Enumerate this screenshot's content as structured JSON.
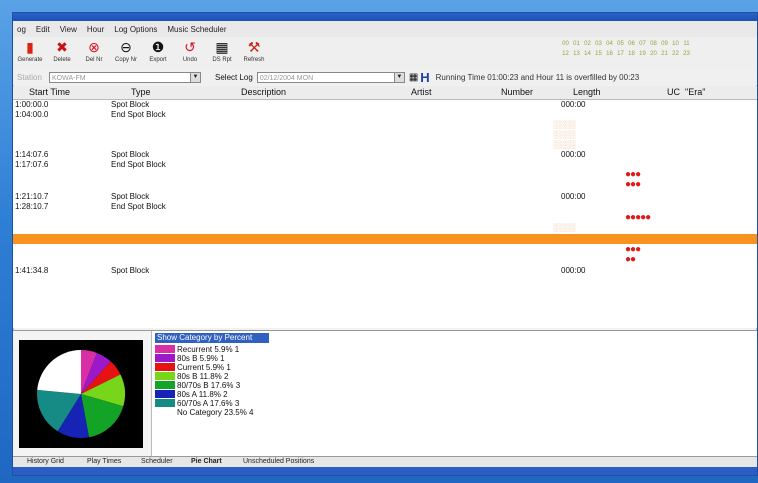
{
  "menu": [
    "og",
    "Edit",
    "View",
    "Hour",
    "Log Options",
    "Music Scheduler"
  ],
  "toolbar": {
    "buttons": [
      {
        "label": "Generate",
        "icon": "generate-icon"
      },
      {
        "label": "Delete",
        "icon": "delete-icon"
      },
      {
        "label": "Del Nr",
        "icon": "del-nr-icon"
      },
      {
        "label": "Copy Nr",
        "icon": "copy-nr-icon"
      },
      {
        "label": "Export",
        "icon": "export-icon"
      },
      {
        "label": "Undo",
        "icon": "undo-icon"
      },
      {
        "label": "DS Rpt",
        "icon": "report-icon"
      },
      {
        "label": "Refresh",
        "icon": "refresh-icon"
      }
    ],
    "hours_row1": [
      "00",
      "01",
      "02",
      "03",
      "04",
      "05",
      "06",
      "07",
      "08",
      "09",
      "10",
      "11"
    ],
    "hours_row2": [
      "12",
      "13",
      "14",
      "15",
      "16",
      "17",
      "18",
      "19",
      "20",
      "21",
      "22",
      "23"
    ]
  },
  "selector": {
    "station_label": "Station",
    "station_value": "KOWA-FM",
    "log_label": "Select Log",
    "log_value": "02/12/2004 MON",
    "running_time": "Running Time 01:00:23 and Hour 11 is overfilled by 00:23"
  },
  "columns": {
    "start": "Start Time",
    "type": "Type",
    "description": "Description",
    "artist": "Artist",
    "number": "Number",
    "length": "Length",
    "uc": "UC",
    "era": "\"Era\""
  },
  "rows": [
    {
      "start": "1:00:00.0",
      "type": "Spot Block",
      "length": "000:00"
    },
    {
      "start": "1:04:00.0",
      "type": "End Spot Block",
      "length": ""
    },
    {
      "start": "1:14:07.6",
      "type": "Spot Block",
      "length": "000:00"
    },
    {
      "start": "1:17:07.6",
      "type": "End Spot Block",
      "length": ""
    },
    {
      "start": "1:21:10.7",
      "type": "Spot Block",
      "length": "000:00"
    },
    {
      "start": "1:28:10.7",
      "type": "End Spot Block",
      "length": ""
    },
    {
      "start": "1:41:34.8",
      "type": "Spot Block",
      "length": "000:00"
    }
  ],
  "ucDots": [
    "●●●",
    "●●●",
    "●●●●●",
    "●●●",
    "●●"
  ],
  "legend": {
    "title": "Show Category by Percent",
    "items": [
      {
        "label": "Recurrent  5.9%  1",
        "color": "#d92fa6"
      },
      {
        "label": "80s B  5.9%  1",
        "color": "#9b19c9"
      },
      {
        "label": "Current  5.9%  1",
        "color": "#e81212"
      },
      {
        "label": "80s B  11.8%  2",
        "color": "#77d61a"
      },
      {
        "label": "80/70s B  17.6%  3",
        "color": "#13a326"
      },
      {
        "label": "80s A  11.8%  2",
        "color": "#1623b5"
      },
      {
        "label": "60/70s A  17.6%  3",
        "color": "#168b86"
      },
      {
        "label": "No Category  23.5%  4",
        "color": "#ffffff"
      }
    ]
  },
  "tabs": [
    "History Grid",
    "Play Times",
    "Scheduler",
    "Pie Chart",
    "Unscheduled Positions"
  ],
  "active_tab": "Pie Chart"
}
